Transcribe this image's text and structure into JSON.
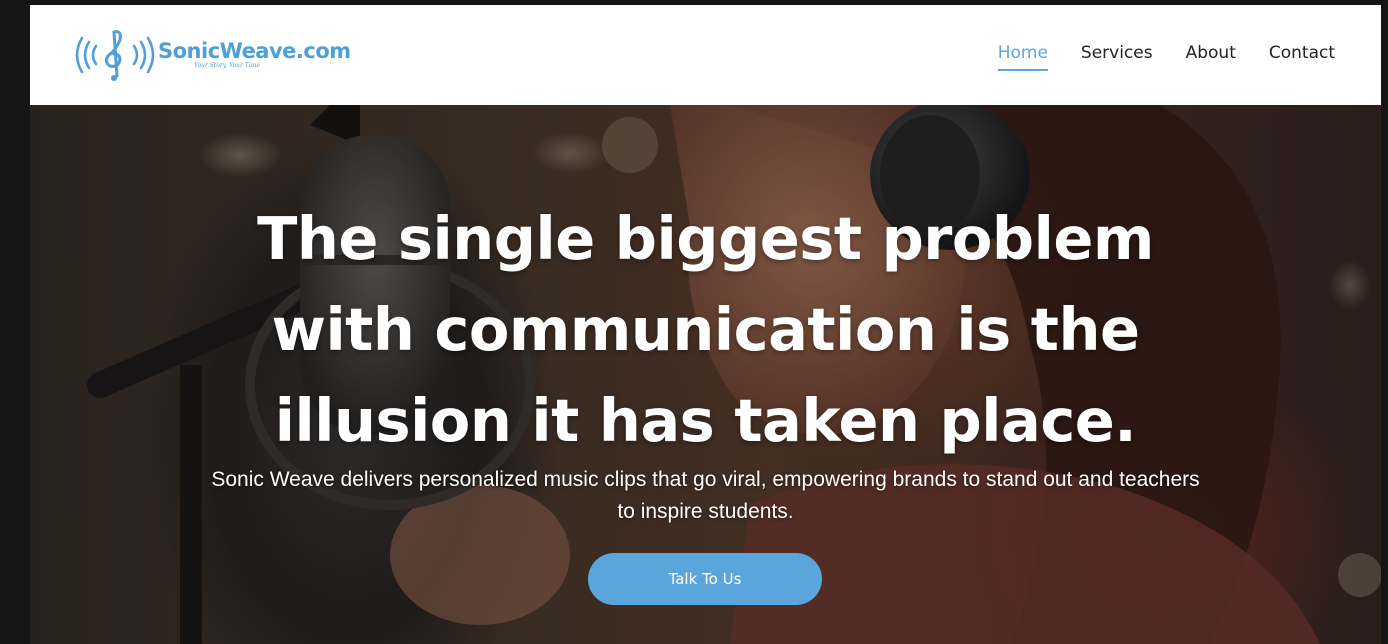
{
  "brand": {
    "name": "SonicWeave.com",
    "tagline": "Your Story, Your Tune",
    "color": "#4f9fd8"
  },
  "nav": {
    "items": [
      {
        "label": "Home",
        "active": true
      },
      {
        "label": "Services",
        "active": false
      },
      {
        "label": "About",
        "active": false
      },
      {
        "label": "Contact",
        "active": false
      }
    ],
    "active_color": "#5aa6dc"
  },
  "hero": {
    "title_lines": [
      "The single biggest problem",
      "with communication is the",
      "illusion it has taken place."
    ],
    "subtitle": "Sonic Weave delivers personalized music clips that go viral, empowering brands to stand out and teachers to inspire students.",
    "cta_label": "Talk To Us",
    "cta_color": "#5aa6dc",
    "background_image": "woman-singing-into-studio-microphone-with-headphones"
  }
}
